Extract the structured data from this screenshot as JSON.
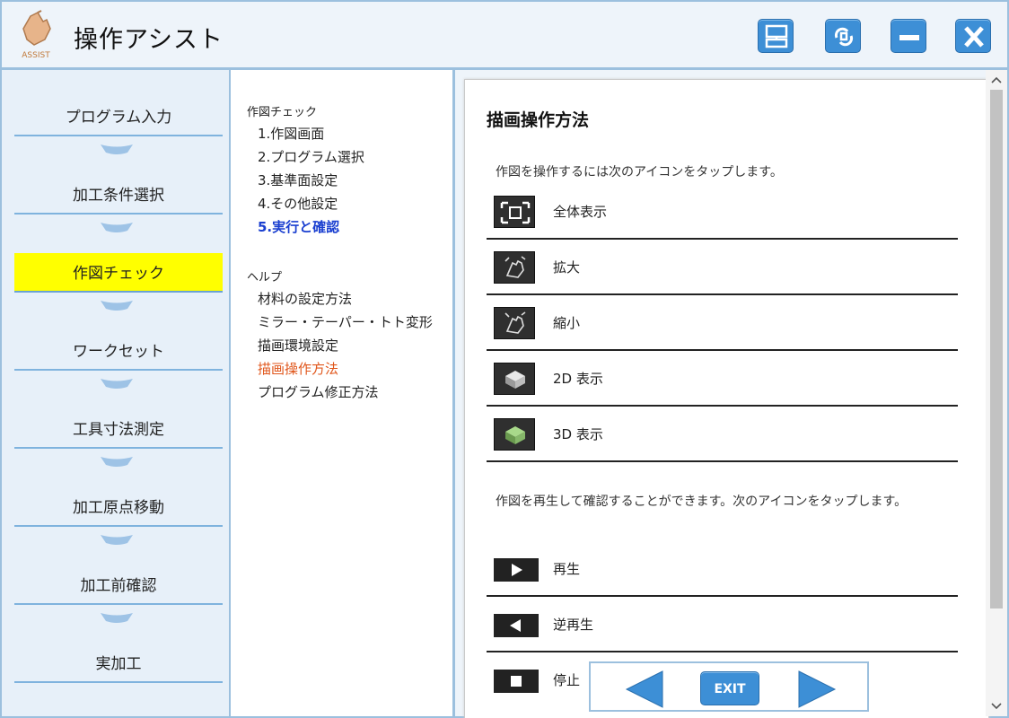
{
  "app": {
    "title": "操作アシスト",
    "logo_text": "ASSIST"
  },
  "colors": {
    "accent_blue": "#3d8fd6",
    "frame_blue": "#9cc0de",
    "active_step": "#ffff00",
    "current_menu": "#1a3fd0",
    "active_menu": "#e0561b"
  },
  "steps": [
    {
      "label": "プログラム入力"
    },
    {
      "label": "加工条件選択"
    },
    {
      "label": "作図チェック"
    },
    {
      "label": "ワークセット"
    },
    {
      "label": "工具寸法測定"
    },
    {
      "label": "加工原点移動"
    },
    {
      "label": "加工前確認"
    },
    {
      "label": "実加工"
    }
  ],
  "menu": {
    "section1_heading": "作図チェック",
    "section1_items": [
      {
        "label": "1.作図画面"
      },
      {
        "label": "2.プログラム選択"
      },
      {
        "label": "3.基準面設定"
      },
      {
        "label": "4.その他設定"
      },
      {
        "label": "5.実行と確認"
      }
    ],
    "section2_heading": "ヘルプ",
    "section2_items": [
      {
        "label": "材料の設定方法"
      },
      {
        "label": "ミラー・テーパー・トト変形"
      },
      {
        "label": "描画環境設定"
      },
      {
        "label": "描画操作方法"
      },
      {
        "label": "プログラム修正方法"
      }
    ]
  },
  "content": {
    "title": "描画操作方法",
    "intro": "作図を操作するには次のアイコンをタップします。",
    "view_items": [
      {
        "label": "全体表示",
        "icon": "fit-all-icon"
      },
      {
        "label": "拡大",
        "icon": "zoom-in-icon"
      },
      {
        "label": "縮小",
        "icon": "zoom-out-icon"
      },
      {
        "label": "2D 表示",
        "icon": "view-2d-icon"
      },
      {
        "label": "3D 表示",
        "icon": "view-3d-icon"
      }
    ],
    "playback_intro": "作図を再生して確認することができます。次のアイコンをタップします。",
    "playback_items": [
      {
        "label": "再生",
        "icon": "play-icon"
      },
      {
        "label": "逆再生",
        "icon": "reverse-icon"
      },
      {
        "label": "停止",
        "icon": "stop-icon"
      }
    ]
  },
  "nav": {
    "exit_label": "EXIT"
  }
}
